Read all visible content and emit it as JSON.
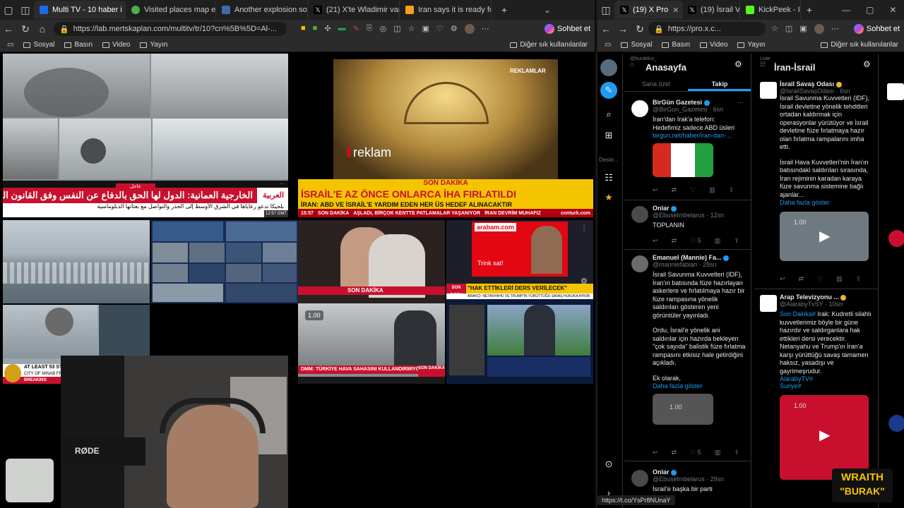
{
  "left_window": {
    "tabs": [
      {
        "label": "Multi TV - 10 haber i",
        "active": true,
        "color": "#1d6ae5"
      },
      {
        "label": "Visited places map editor",
        "active": false,
        "color": "#4caf50"
      },
      {
        "label": "Another explosion sound",
        "active": false,
        "color": "#3a6ea5"
      },
      {
        "label": "(21) X'te Wladimir van W",
        "active": false,
        "color": "#000000"
      },
      {
        "label": "Iran says it is ready for wa",
        "active": false,
        "color": "#f6a019"
      }
    ],
    "url": "https://lab.mertskaplan.com/multitv/tr/10?cn%5B%5D=Al-...",
    "copilot_label": "Sohbet et",
    "bookmarks": [
      "Sosyal",
      "Basın",
      "Video",
      "Yayın"
    ],
    "other_bookmarks": "Diğer sık kullanılanlar"
  },
  "right_window": {
    "tabs": [
      {
        "label": "(19) X Pro",
        "active": true
      },
      {
        "label": "(19) İsrail V",
        "active": false
      },
      {
        "label": "KickPeek - I",
        "active": false
      }
    ],
    "url": "https://pro.x.c...",
    "copilot_label": "Sohbet et",
    "bookmarks": [
      "Sosyal",
      "Basın",
      "Video",
      "Yayın"
    ],
    "other_bookmarks": "Diğer sık kullanılanlar"
  },
  "tiles": {
    "alarabiya": {
      "channel": "العربية",
      "urgent": "عاجل",
      "headline": "الخارجية العمانية: الدول لها الحق بالدفاع عن النفس وفق القانون الدولي",
      "subline": "بلجيكا تدعو رعاياها في الشرق الأوسط إلى الحذر والتواصل مع بعثاتها الدبلوماسية",
      "time": "12:57 GMT"
    },
    "cnnturk": {
      "ad_label": "REKLAMLAR",
      "ad_text": "reklam",
      "breaking": "SON DAKİKA",
      "headline": "İSRAİL'E AZ ÖNCE ONLARCA İHA FIRLATILDI",
      "subline": "İRAN: ABD VE İSRAİL'E YARDIM EDEN HER ÜS HEDEF ALINACAKTIR",
      "ticker_time": "15:57",
      "ticker_label": "SON DAKİKA",
      "ticker_text": "AŞLADI, BİRÇOK KENTTE PATLAMALAR YAŞANIYOR",
      "ticker_right": "İRAN DEVRİM MUHAFIZ",
      "brand": "cnnturk.com"
    },
    "arabam": {
      "brand": "arabam.com",
      "cta": "Trink sat!"
    },
    "ahaber": {
      "headline": "\"HAK ETTİKLERİ DERS VERİLECEK\"",
      "badge": "SON dakika",
      "subline": "ARAKÇİ: NETANYAHU VE TRUMP'IN YÜRÜTTÜĞÜ SAVAŞ HUKUKA AYKIRI"
    },
    "dmm": {
      "overlay": "1.00",
      "headline": "DMM: TÜRKİYE HAVA SAHASINI KULLANDIRMIYOR",
      "badge": "SON DAKİKA"
    },
    "aljazeera": {
      "headline": "AT LEAST 53 STUDENTS KILLED",
      "subline": "CITY OF MINAB FROM",
      "badge": "BREAKING"
    },
    "camera": {
      "mic": "RØDE"
    }
  },
  "xpro": {
    "home": {
      "handle": "@burakkut_",
      "title": "Anasayfa",
      "tabs": [
        "Sana özel",
        "Takip"
      ],
      "active_tab": "Takip"
    },
    "list": {
      "label": "Liste",
      "title": "İran-İsrail"
    },
    "sidebar_label": "Deste...",
    "home_tweets": [
      {
        "name": "BirGün Gazetesi",
        "handle": "@BirGun_Gazetesi · 6sn",
        "text": "İran'dan Irak'a telefon: Hedefimiz sadece ABD üsleri",
        "link": "birgun.net/haber/iran-dan-...",
        "likes": "",
        "avatar_color": "#ffffff"
      },
      {
        "name": "Onlar",
        "handle": "@Ebuselmbelarus · 12sn",
        "text": "TOPLANIN",
        "likes": "5",
        "avatar_color": "#4a4a4a"
      },
      {
        "name": "Emanuel (Mannie) Fa...",
        "handle": "@manniefabian · 28sn",
        "text": "İsrail Savunma Kuvvetleri (IDF), İran'ın batısında füze hazırlayan askerlere ve fırlatılmaya hazır bir füze rampasına yönelik saldırıları gösteren yeni görüntüler yayınladı.",
        "text2": "Ordu, İsrail'e yönelik ani saldırılar için hazırda bekleyen \"çok sayıda\" balistik füze fırlatma rampasını etkisiz hale getirdiğini açıkladı.",
        "text3": "Ek olarak,",
        "more": "Daha fazla göster",
        "video_label": "1.00",
        "likes": "5",
        "avatar_color": "#6b6b6b"
      },
      {
        "name": "Onlar",
        "handle": "@Ebuselmbelarus · 29sn",
        "text": "İsrail'e başka bir parti",
        "avatar_color": "#4a4a4a"
      }
    ],
    "list_tweets": [
      {
        "name": "İsrail Savaş Odası",
        "handle": "@IsrailSavaşOdası · 6sn",
        "text": "İsrail Savunma Kuvvetleri (IDF), İsrail devletine yönelik tehditleri ortadan kaldırmak için operasyonlar yürütüyor ve İsrail devletine füze fırlatmaya hazır olan fırlatma rampalarını imha etti.",
        "text2": "İsrail Hava Kuvvetleri'nin İran'ın batısındaki saldırıları sırasında, İran rejiminin karadan karaya füze savunma sistemine bağlı ajanlar...",
        "more": "Daha fazla göster",
        "video_label": "1.00",
        "avatar_color": "#ffffff"
      },
      {
        "name": "Arap Televizyonu ...",
        "handle": "@AlarabyTvSY · 10sn",
        "tag": "Son Dakika#",
        "text": "Irak: Kudretli silahlı kuvvetlerimiz böyle bir güne hazırdır ve saldırganlara hak ettikleri dersi verecektir.",
        "text2": "Netanyahu ve Trump'ın İran'a karşı yürüttüğü savaş tamamen haksız, yasadışı ve gayrimeşrudur.",
        "hashtags": [
          "AlarabyTV#",
          "Suriye#"
        ],
        "video_label": "1.00",
        "avatar_color": "#ffffff"
      }
    ],
    "status_url": "https://t.co/YsPr8NUnaY"
  },
  "overlay": {
    "line1": "WRAITH",
    "line2": "\"BURAK\""
  },
  "colors": {
    "x_blue": "#1d9bf0",
    "alarabiya_red": "#c8102e",
    "cnn_yellow": "#f5c400",
    "overlay_yellow": "#f5c400"
  }
}
